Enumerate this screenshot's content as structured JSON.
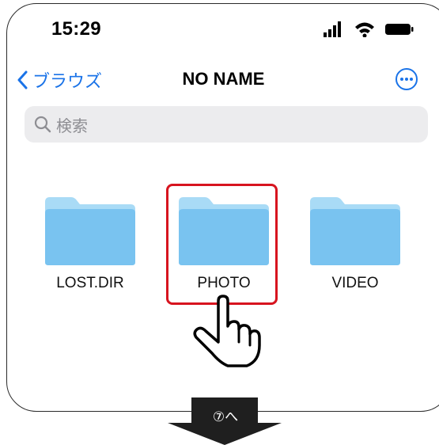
{
  "status_bar": {
    "time": "15:29",
    "icons": [
      "cellular-signal-icon",
      "wifi-icon",
      "battery-icon"
    ]
  },
  "nav": {
    "back_label": "ブラウズ",
    "title": "NO NAME",
    "more_icon": "ellipsis-circle-icon"
  },
  "search": {
    "placeholder": "検索"
  },
  "folders": [
    {
      "name": "LOST.DIR"
    },
    {
      "name": "PHOTO"
    },
    {
      "name": "VIDEO"
    }
  ],
  "annotation": {
    "highlighted_folder": "PHOTO",
    "next_step_label": "⑦へ",
    "highlight_color": "#d7141f"
  },
  "colors": {
    "accent": "#1a73e8",
    "folder_body": "#79c3f0",
    "folder_tab": "#a9dbf6",
    "search_bg": "#ececee"
  }
}
